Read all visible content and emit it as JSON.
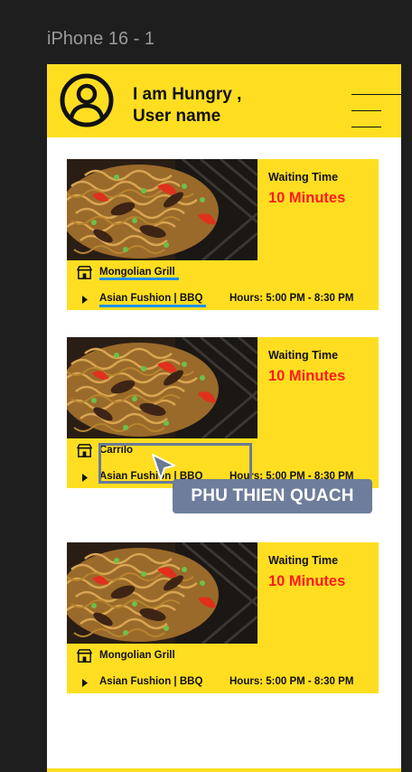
{
  "frame": {
    "label": "iPhone 16 - 1"
  },
  "header": {
    "greeting_line1": "I am Hungry ,",
    "greeting_line2": "User name",
    "avatar_icon": "user-circle-icon",
    "menu_icon": "hamburger-menu-icon"
  },
  "colors": {
    "accent": "#ffde21",
    "waiting_value": "#ff1a1a",
    "link_underline": "#1f8ff0",
    "collaborator": "#6d7d9b"
  },
  "cards": [
    {
      "waiting_label": "Waiting Time",
      "waiting_value": "10 Minutes",
      "restaurant": "Mongolian Grill",
      "cuisine": "Asian Fushion | BBQ",
      "hours": "Hours: 5:00 PM - 8:30 PM"
    },
    {
      "waiting_label": "Waiting Time",
      "waiting_value": "10 Minutes",
      "restaurant": "Carrilo",
      "cuisine": "Asian Fushion | BBQ",
      "hours": "Hours: 5:00 PM - 8:30 PM"
    },
    {
      "waiting_label": "Waiting Time",
      "waiting_value": "10 Minutes",
      "restaurant": "Mongolian Grill",
      "cuisine": "Asian Fushion | BBQ",
      "hours": "Hours: 5:00 PM - 8:30 PM"
    }
  ],
  "collaborator": {
    "name": "PHU THIEN QUACH",
    "cursor_icon": "pointer-cursor-icon"
  }
}
